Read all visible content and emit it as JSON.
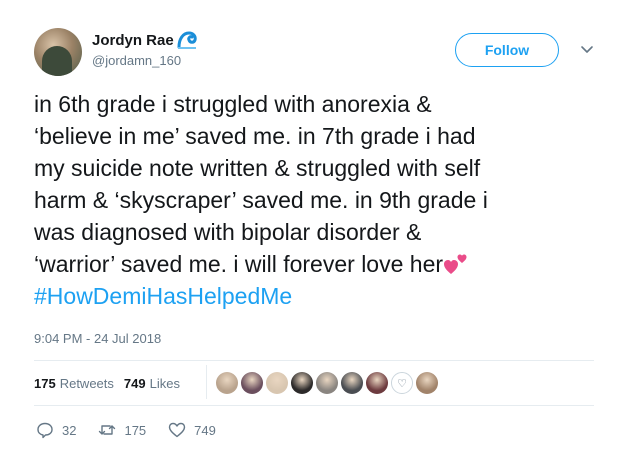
{
  "user": {
    "display_name": "Jordyn Rae",
    "handle": "@jordamn_160",
    "avatar": "profile-photo",
    "emoji": "water-wave-icon"
  },
  "header": {
    "follow_label": "Follow",
    "menu_icon": "chevron-down-icon"
  },
  "tweet": {
    "lines": [
      "in 6th grade i struggled with anorexia &",
      "‘believe in me’ saved me. in 7th grade i had",
      "my suicide note written & struggled with self",
      "harm & ‘skyscraper’ saved me. in 9th grade i",
      "was diagnosed with bipolar disorder &",
      "‘warrior’ saved me. i will forever love her"
    ],
    "trailing_emoji": "two-hearts-icon",
    "hashtag": "#HowDemiHasHelpedMe",
    "timestamp": "9:04 PM - 24 Jul 2018"
  },
  "stats": {
    "retweets_count": "175",
    "retweets_label": "Retweets",
    "likes_count": "749",
    "likes_label": "Likes"
  },
  "likers": [
    {
      "color": "#b9a38d"
    },
    {
      "color": "#6b4f5e"
    },
    {
      "color": "#d8c6b0"
    },
    {
      "color": "#2c2a2a"
    },
    {
      "color": "#8a8580"
    },
    {
      "color": "#4a4d52"
    },
    {
      "color": "#6d3b3f"
    },
    {
      "color": "#ffffff"
    },
    {
      "color": "#a1836a"
    }
  ],
  "actions": {
    "replies": "32",
    "retweets": "175",
    "likes": "749"
  },
  "colors": {
    "accent": "#1da1f2",
    "secondary_text": "#657786",
    "heart_pink": "#e0245e"
  }
}
